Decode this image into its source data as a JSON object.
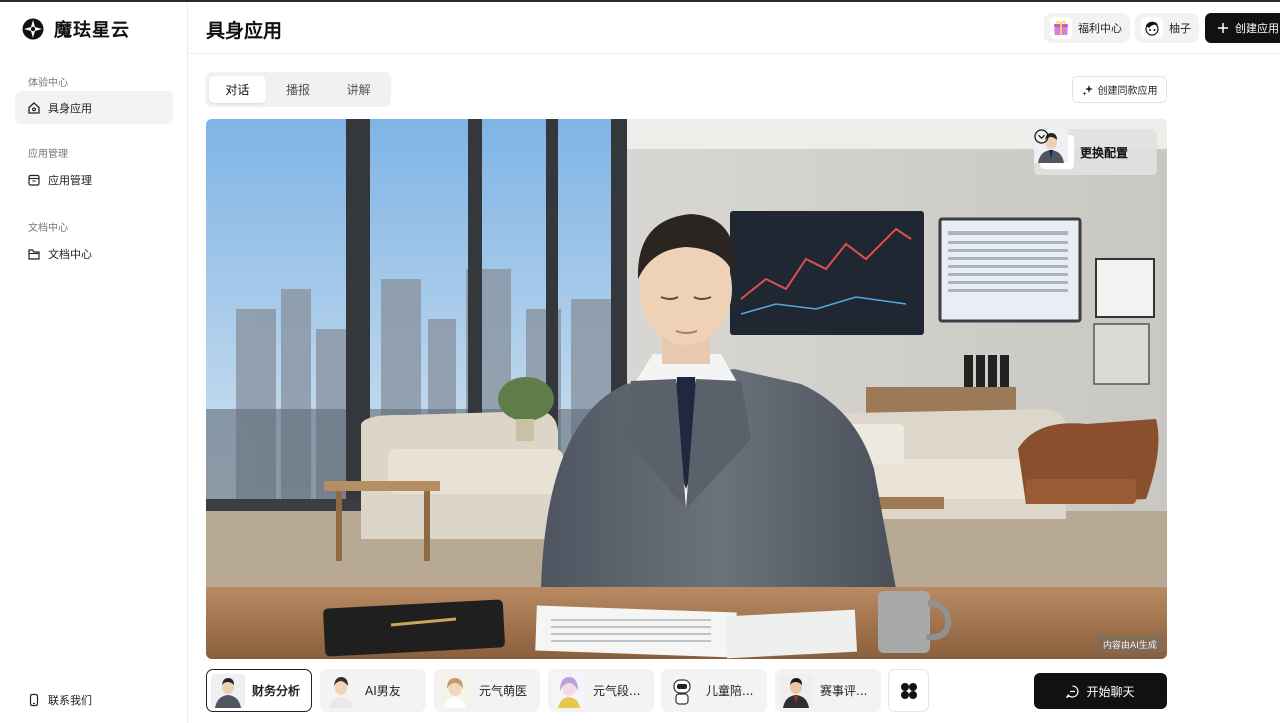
{
  "sidebar": {
    "brand": "魔珐星云",
    "groups": [
      {
        "title": "体验中心",
        "items": [
          {
            "label": "具身应用",
            "icon": "home-icon"
          }
        ]
      },
      {
        "title": "应用管理",
        "items": [
          {
            "label": "应用管理",
            "icon": "app-box-icon"
          }
        ]
      },
      {
        "title": "文档中心",
        "items": [
          {
            "label": "文档中心",
            "icon": "folder-icon"
          }
        ]
      }
    ],
    "contact_label": "联系我们"
  },
  "header": {
    "title": "具身应用",
    "welfare_label": "福利中心",
    "user_name": "柚子",
    "create_label": "创建应用"
  },
  "tabs": [
    {
      "label": "对话",
      "active": true
    },
    {
      "label": "播报",
      "active": false
    },
    {
      "label": "讲解",
      "active": false
    }
  ],
  "clone_button_label": "创建同款应用",
  "stage": {
    "config_label": "更换配置",
    "ai_badge": "内容由AI生成"
  },
  "personas": [
    {
      "label": "财务分析",
      "active": true
    },
    {
      "label": "AI男友",
      "active": false
    },
    {
      "label": "元气萌医",
      "active": false
    },
    {
      "label": "元气段...",
      "active": false
    },
    {
      "label": "儿童陪...",
      "active": false
    },
    {
      "label": "赛事评...",
      "active": false
    }
  ],
  "start_chat_label": "开始聊天",
  "colors": {
    "accent": "#111111",
    "sidebar_active": "#f2f2f2"
  }
}
